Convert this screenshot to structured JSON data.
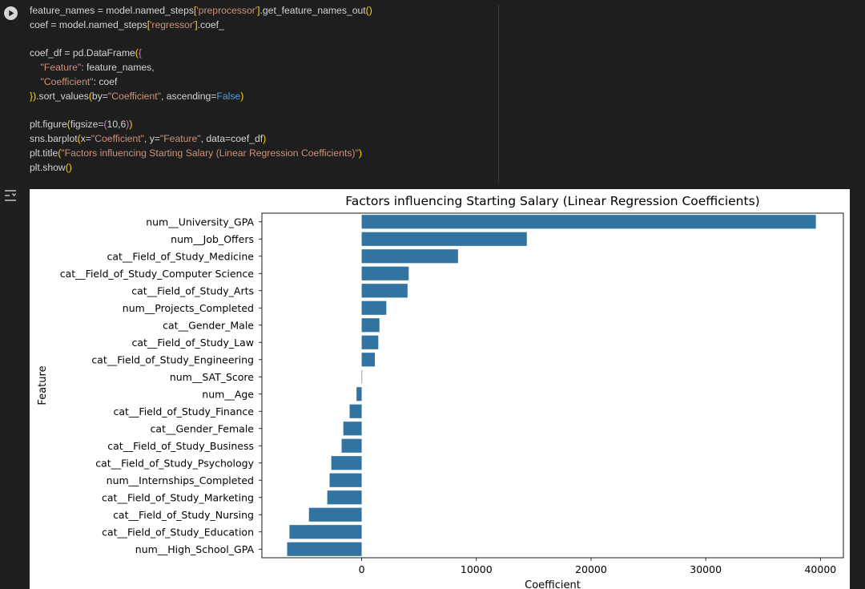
{
  "code_cell": {
    "lines": [
      "feature_names = model.named_steps['preprocessor'].get_feature_names_out()",
      "coef = model.named_steps['regressor'].coef_",
      "",
      "coef_df = pd.DataFrame({",
      "    \"Feature\": feature_names,",
      "    \"Coefficient\": coef",
      "}).sort_values(by=\"Coefficient\", ascending=False)",
      "",
      "plt.figure(figsize=(10,6))",
      "sns.barplot(x=\"Coefficient\", y=\"Feature\", data=coef_df)",
      "plt.title(\"Factors influencing Starting Salary (Linear Regression Coefficients)\")",
      "plt.show()"
    ]
  },
  "icons": {
    "run": "play-icon",
    "output_toggle": "output-collapse-icon"
  },
  "colors": {
    "bar": "#3274a1",
    "editor_bg": "#1e1e1e",
    "string": "#ce9178",
    "keyword": "#569cd6"
  },
  "chart_data": {
    "type": "bar",
    "orientation": "horizontal",
    "title": "Factors influencing Starting Salary (Linear Regression Coefficients)",
    "xlabel": "Coefficient",
    "ylabel": "Feature",
    "xlim": [
      -8700,
      42000
    ],
    "xticks": [
      0,
      10000,
      20000,
      30000,
      40000
    ],
    "grid": false,
    "categories": [
      "num__University_GPA",
      "num__Job_Offers",
      "cat__Field_of_Study_Medicine",
      "cat__Field_of_Study_Computer Science",
      "cat__Field_of_Study_Arts",
      "num__Projects_Completed",
      "cat__Gender_Male",
      "cat__Field_of_Study_Law",
      "cat__Field_of_Study_Engineering",
      "num__SAT_Score",
      "num__Age",
      "cat__Field_of_Study_Finance",
      "cat__Gender_Female",
      "cat__Field_of_Study_Business",
      "cat__Field_of_Study_Psychology",
      "num__Internships_Completed",
      "cat__Field_of_Study_Marketing",
      "cat__Field_of_Study_Nursing",
      "cat__Field_of_Study_Education",
      "num__High_School_GPA"
    ],
    "values": [
      39600,
      14400,
      8400,
      4100,
      4000,
      2150,
      1550,
      1450,
      1150,
      20,
      -450,
      -1050,
      -1600,
      -1750,
      -2650,
      -2800,
      -3000,
      -4600,
      -6300,
      -6500
    ]
  }
}
